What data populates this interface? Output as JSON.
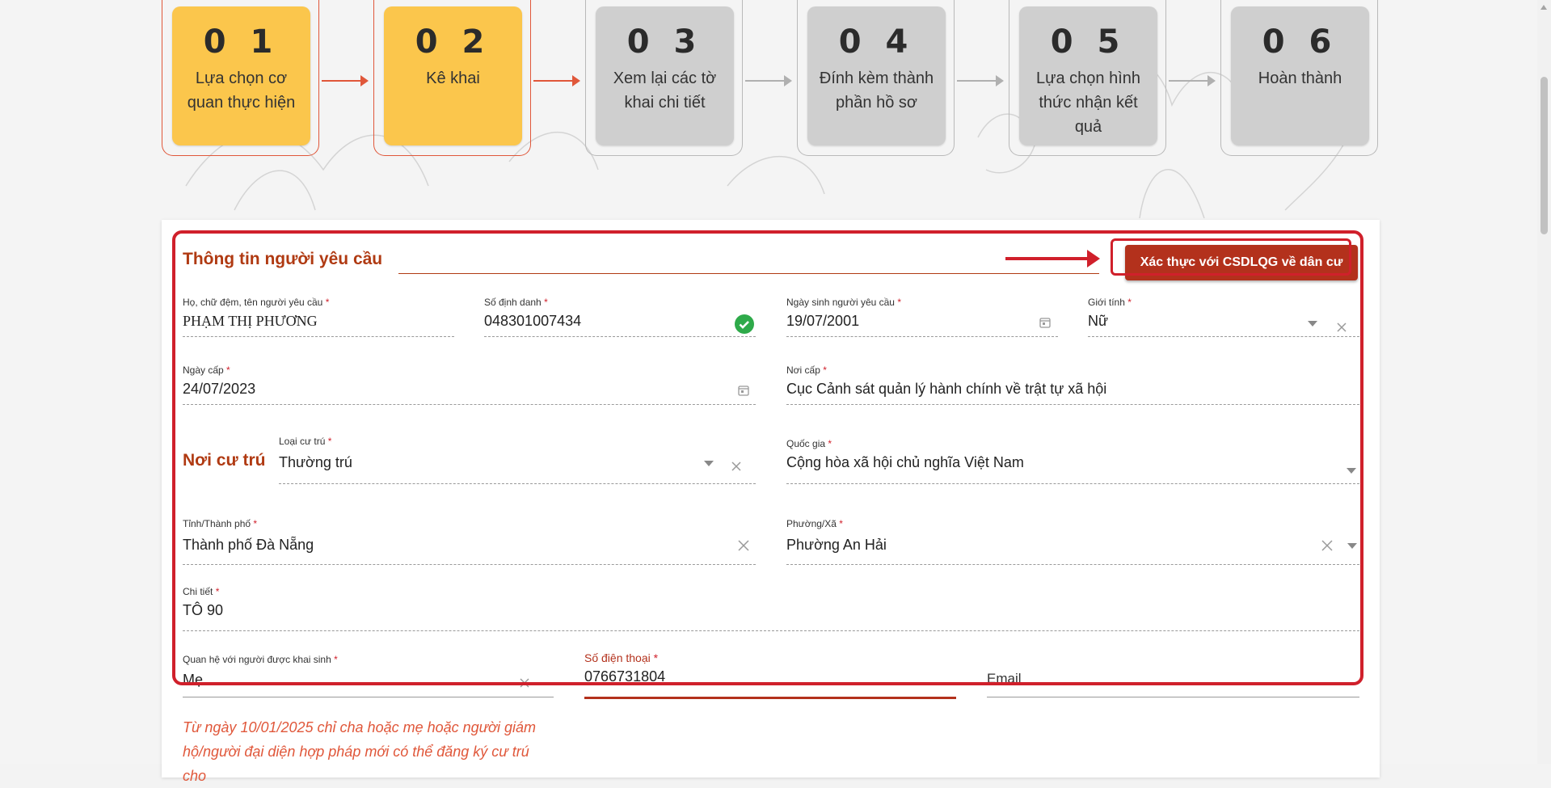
{
  "steps": [
    {
      "num": "0 1",
      "label": "Lựa chọn cơ quan thực hiện",
      "active": true
    },
    {
      "num": "0 2",
      "label": "Kê khai",
      "active": true
    },
    {
      "num": "0 3",
      "label": "Xem lại các tờ khai chi tiết",
      "active": false
    },
    {
      "num": "0 4",
      "label": "Đính kèm thành phần hồ sơ",
      "active": false
    },
    {
      "num": "0 5",
      "label": "Lựa chọn hình thức nhận kết quả",
      "active": false
    },
    {
      "num": "0 6",
      "label": "Hoàn thành",
      "active": false
    }
  ],
  "section": {
    "title": "Thông tin người yêu cầu",
    "verify_button": "Xác thực với CSDLQG về dân cư",
    "residence_title": "Nơi cư trú"
  },
  "fields": {
    "full_name": {
      "label": "Họ, chữ đệm, tên người yêu cầu",
      "value": "PHẠM THỊ PHƯƠNG"
    },
    "id_number": {
      "label": "Số định danh",
      "value": "048301007434"
    },
    "dob": {
      "label": "Ngày sinh người yêu cầu",
      "value": "19/07/2001"
    },
    "gender": {
      "label": "Giới tính",
      "value": "Nữ"
    },
    "issue_date": {
      "label": "Ngày cấp",
      "value": "24/07/2023"
    },
    "issue_place": {
      "label": "Nơi cấp",
      "value": "Cục Cảnh sát quản lý hành chính về trật tự xã hội"
    },
    "residence_type": {
      "label": "Loại cư trú",
      "value": "Thường trú"
    },
    "country": {
      "label": "Quốc gia",
      "value": "Cộng hòa xã hội chủ nghĩa Việt Nam"
    },
    "province": {
      "label": "Tỉnh/Thành phố",
      "value": "Thành phố Đà Nẵng"
    },
    "ward": {
      "label": "Phường/Xã",
      "value": "Phường An Hải"
    },
    "detail": {
      "label": "Chi tiết",
      "value": "TÔ 90"
    },
    "relation": {
      "label": "Quan hệ với người được khai sinh",
      "value": "Mẹ"
    },
    "phone": {
      "label": "Số điện thoại",
      "value": "0766731804"
    },
    "email": {
      "label": "Email",
      "value": ""
    }
  },
  "note": "Từ ngày 10/01/2025 chỉ cha hoặc mẹ hoặc người giám hộ/người đại diện hợp pháp mới có thể đăng ký cư trú cho",
  "colors": {
    "accent": "#b3311c",
    "highlight": "#d0202b",
    "step_active": "#fbc64c",
    "step_inactive": "#cfcfcf"
  },
  "icons": [
    "check-circle-icon",
    "calendar-icon",
    "dropdown-arrow-icon",
    "clear-icon"
  ]
}
